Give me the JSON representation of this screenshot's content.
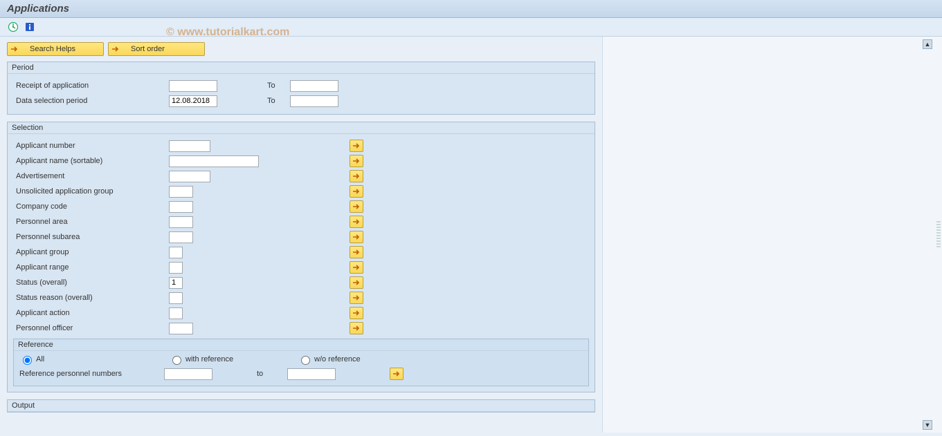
{
  "title": "Applications",
  "watermark": "© www.tutorialkart.com",
  "toolbar_buttons": {
    "search_helps": "Search Helps",
    "sort_order": "Sort order"
  },
  "panels": {
    "period": {
      "title": "Period",
      "rows": {
        "receipt": {
          "label": "Receipt of application",
          "from": "",
          "to_label": "To",
          "to": ""
        },
        "data_sel": {
          "label": "Data selection period",
          "from": "12.08.2018",
          "to_label": "To",
          "to": ""
        }
      }
    },
    "selection": {
      "title": "Selection",
      "fields": [
        {
          "label": "Applicant number",
          "value": "",
          "width": "w60"
        },
        {
          "label": "Applicant name (sortable)",
          "value": "",
          "width": "w130"
        },
        {
          "label": "Advertisement",
          "value": "",
          "width": "w60"
        },
        {
          "label": "Unsolicited application group",
          "value": "",
          "width": "w35"
        },
        {
          "label": "Company code",
          "value": "",
          "width": "w35"
        },
        {
          "label": "Personnel area",
          "value": "",
          "width": "w35"
        },
        {
          "label": "Personnel subarea",
          "value": "",
          "width": "w35"
        },
        {
          "label": "Applicant group",
          "value": "",
          "width": "w20"
        },
        {
          "label": "Applicant range",
          "value": "",
          "width": "w20"
        },
        {
          "label": "Status (overall)",
          "value": "1",
          "width": "w20"
        },
        {
          "label": "Status reason (overall)",
          "value": "",
          "width": "w20"
        },
        {
          "label": "Applicant action",
          "value": "",
          "width": "w20"
        },
        {
          "label": "Personnel officer",
          "value": "",
          "width": "w35"
        }
      ],
      "reference": {
        "title": "Reference",
        "radios": {
          "all": "All",
          "with": "with reference",
          "without": "w/o reference"
        },
        "selected": "all",
        "ref_pernr": {
          "label": "Reference personnel numbers",
          "from": "",
          "to_label": "to",
          "to": ""
        }
      }
    },
    "output": {
      "title": "Output"
    }
  }
}
